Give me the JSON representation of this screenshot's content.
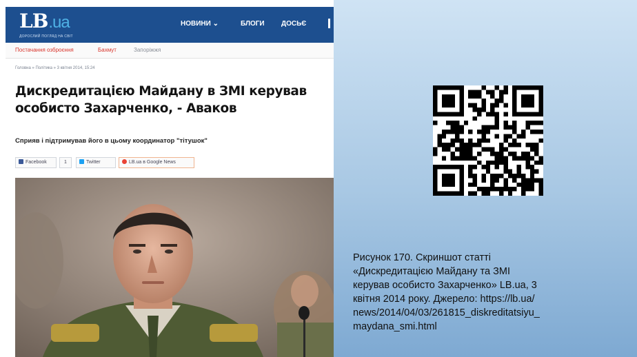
{
  "site": {
    "logo": "LB",
    "logo_domain": ".ua",
    "tagline": "ДОРОСЛИЙ ПОГЛЯД НА СВІТ"
  },
  "nav": {
    "news": "НОВИНИ ⌄",
    "blogs": "БЛОГИ",
    "dossier": "ДОСЬЄ"
  },
  "trending": [
    "Постачання озброєння",
    "Бахмут",
    "Запоріжжя"
  ],
  "breadcrumb": "Головна » Політика » 3 квітня 2014, 15:24",
  "article": {
    "headline": "Дискредитацією Майдану в ЗМІ керував особисто Захарченко, - Аваков",
    "lead": "Сприяв і підтримував його в цьому координатор \"тітушок\""
  },
  "share": {
    "facebook": "Facebook",
    "facebook_count": "1",
    "twitter": "Twitter",
    "google_news": "LB.ua в Google News",
    "colors": {
      "facebook": "#3b5998",
      "twitter": "#1da1f2",
      "google": "#ea4335"
    }
  },
  "caption": "Рисунок 170. Скриншот статті\n«Дискредитацією Майдану та ЗМІ\nкерував особисто Захарченко» LB.ua, 3\nквітня 2014 року. Джерело: https://lb.ua/\nnews/2014/04/03/261815_diskreditatsiyu_\nmaydana_smi.html",
  "colors": {
    "brand_blue": "#1d4f8f",
    "logo_accent": "#4fb2e6",
    "trend_red": "#d8332a",
    "panel_top": "#cfe3f4",
    "panel_bottom": "#7ea9d2"
  }
}
